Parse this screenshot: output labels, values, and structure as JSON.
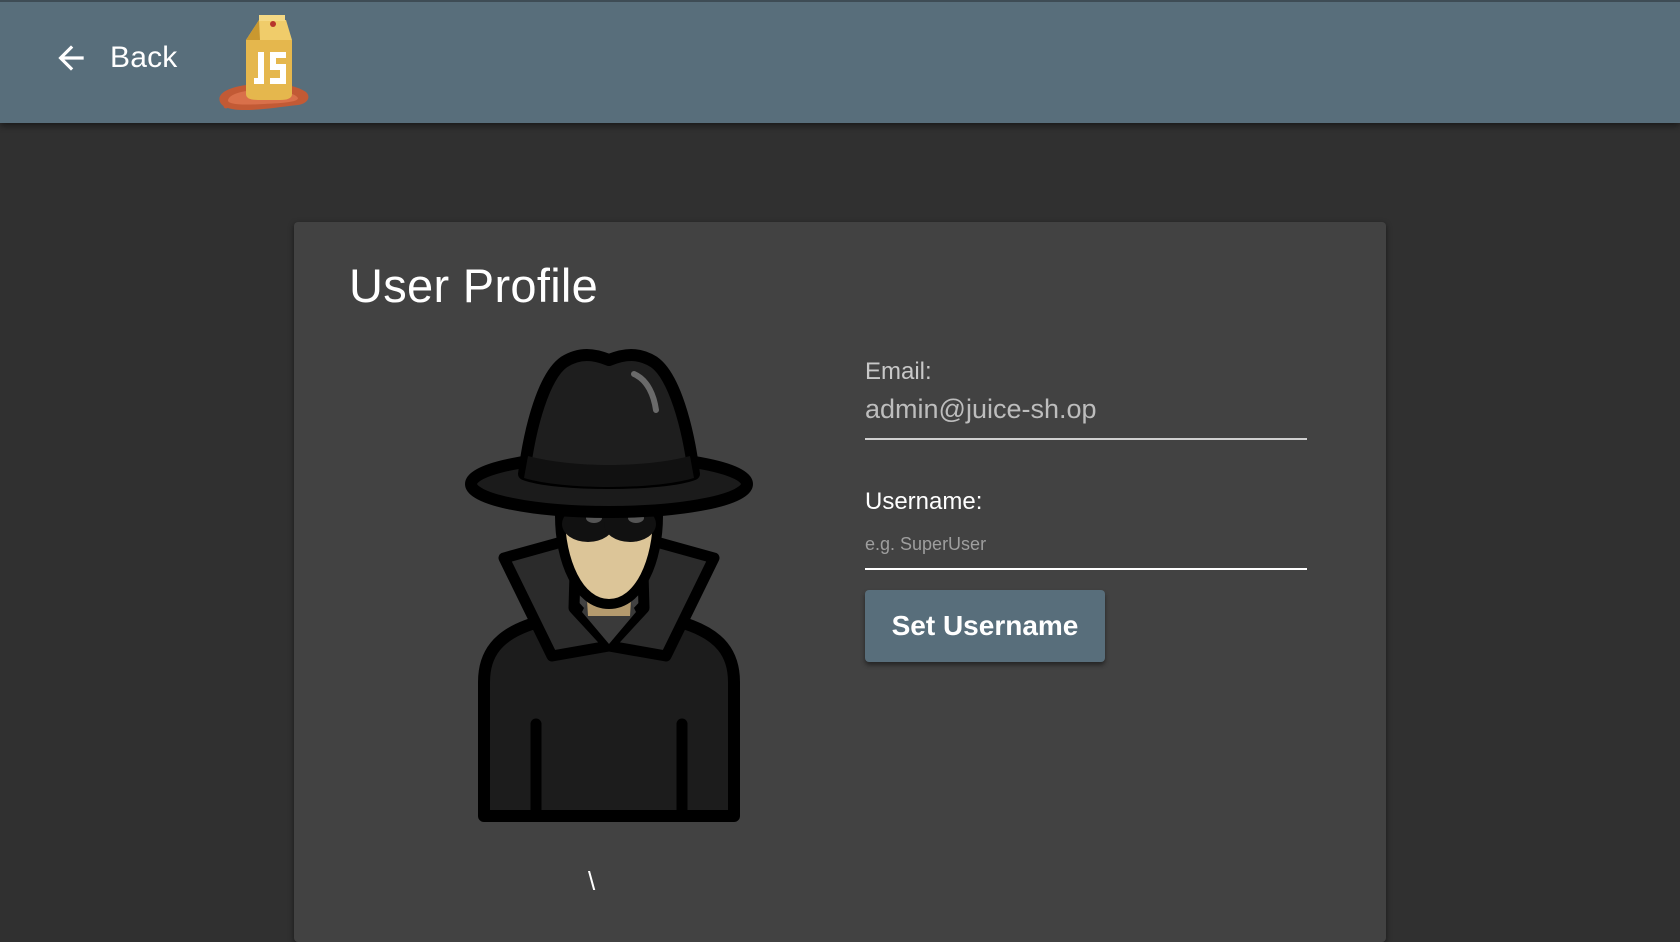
{
  "header": {
    "back_label": "Back",
    "back_icon": "arrow-left-icon",
    "logo": "juice-shop-logo"
  },
  "profile": {
    "title": "User Profile",
    "avatar": "spy-avatar-image",
    "avatar_caption": "\\",
    "email_label": "Email:",
    "email_value": "admin@juice-sh.op",
    "username_label": "Username:",
    "username_value": "",
    "username_placeholder": "e.g. SuperUser",
    "set_username_label": "Set Username"
  },
  "colors": {
    "toolbar": "#586e7b",
    "background": "#303030",
    "card": "#424242",
    "button": "#586e7b",
    "text": "#ffffff"
  }
}
